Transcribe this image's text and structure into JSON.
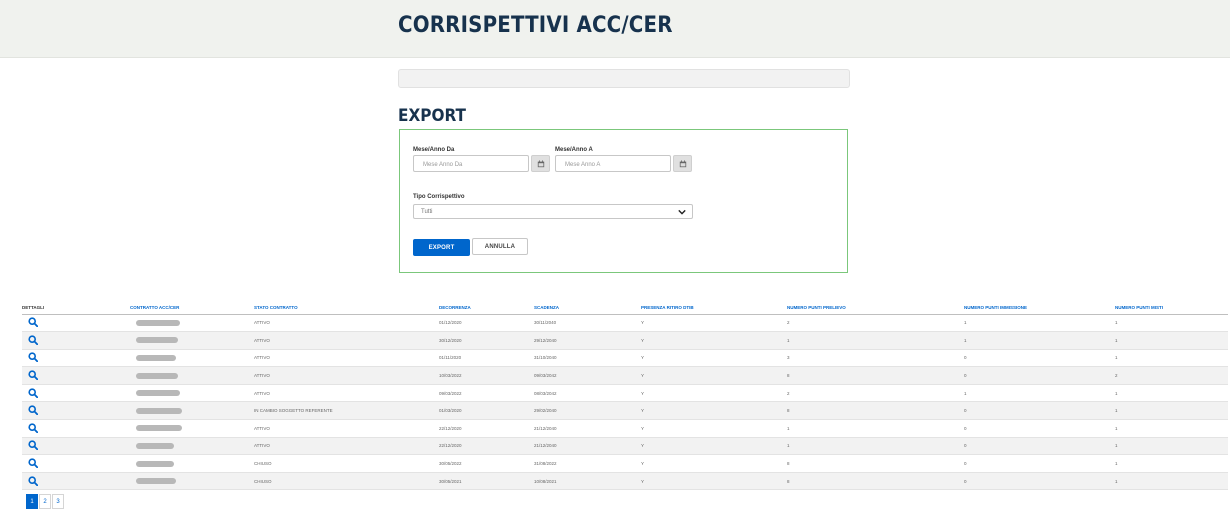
{
  "header": {
    "title": "CORRISPETTIVI ACC/CER"
  },
  "export": {
    "title": "EXPORT",
    "from_label": "Mese/Anno Da",
    "from_placeholder": "Mese Anno Da",
    "to_label": "Mese/Anno A",
    "to_placeholder": "Mese Anno A",
    "type_label": "Tipo Corrispettivo",
    "type_value": "Tutti",
    "export_button": "EXPORT",
    "cancel_button": "ANNULLA"
  },
  "table": {
    "columns": [
      "DETTAGLI",
      "CONTRATTO ACC/CER",
      "STATO CONTRATTO",
      "DECORRENZA",
      "SCADENZA",
      "PRESENZA RITIRO DTIB",
      "NUMERO PUNTI PRELIEVO",
      "NUMERO PUNTI IMMISSIONE",
      "NUMERO PUNTI MISTI"
    ],
    "rows": [
      {
        "stato": "ATTIVO",
        "decorrenza": "01/12/2020",
        "scadenza": "30/11/2040",
        "ritiro": "Y",
        "prelievo": "2",
        "immissione": "1",
        "misti": "1"
      },
      {
        "stato": "ATTIVO",
        "decorrenza": "30/12/2020",
        "scadenza": "29/12/2040",
        "ritiro": "Y",
        "prelievo": "1",
        "immissione": "1",
        "misti": "1"
      },
      {
        "stato": "ATTIVO",
        "decorrenza": "01/11/2020",
        "scadenza": "31/10/2040",
        "ritiro": "Y",
        "prelievo": "3",
        "immissione": "0",
        "misti": "1"
      },
      {
        "stato": "ATTIVO",
        "decorrenza": "10/03/2022",
        "scadenza": "09/03/2042",
        "ritiro": "Y",
        "prelievo": "8",
        "immissione": "0",
        "misti": "2"
      },
      {
        "stato": "ATTIVO",
        "decorrenza": "09/03/2022",
        "scadenza": "08/03/2042",
        "ritiro": "Y",
        "prelievo": "2",
        "immissione": "1",
        "misti": "1"
      },
      {
        "stato": "IN CAMBIO SOGGETTO REFERENTE",
        "decorrenza": "01/03/2020",
        "scadenza": "29/02/2040",
        "ritiro": "Y",
        "prelievo": "8",
        "immissione": "0",
        "misti": "1"
      },
      {
        "stato": "ATTIVO",
        "decorrenza": "22/12/2020",
        "scadenza": "21/12/2040",
        "ritiro": "Y",
        "prelievo": "1",
        "immissione": "0",
        "misti": "1"
      },
      {
        "stato": "ATTIVO",
        "decorrenza": "22/12/2020",
        "scadenza": "21/12/2040",
        "ritiro": "Y",
        "prelievo": "1",
        "immissione": "0",
        "misti": "1"
      },
      {
        "stato": "CHIUSO",
        "decorrenza": "30/05/2022",
        "scadenza": "31/08/2022",
        "ritiro": "Y",
        "prelievo": "8",
        "immissione": "0",
        "misti": "1"
      },
      {
        "stato": "CHIUSO",
        "decorrenza": "30/05/2021",
        "scadenza": "10/08/2021",
        "ritiro": "Y",
        "prelievo": "8",
        "immissione": "0",
        "misti": "1"
      }
    ]
  },
  "pagination": {
    "pages": [
      "1",
      "2",
      "3"
    ],
    "active": "1"
  },
  "colors": {
    "primary": "#0066cc",
    "title": "#17324d",
    "box_border": "#7bc77b"
  }
}
